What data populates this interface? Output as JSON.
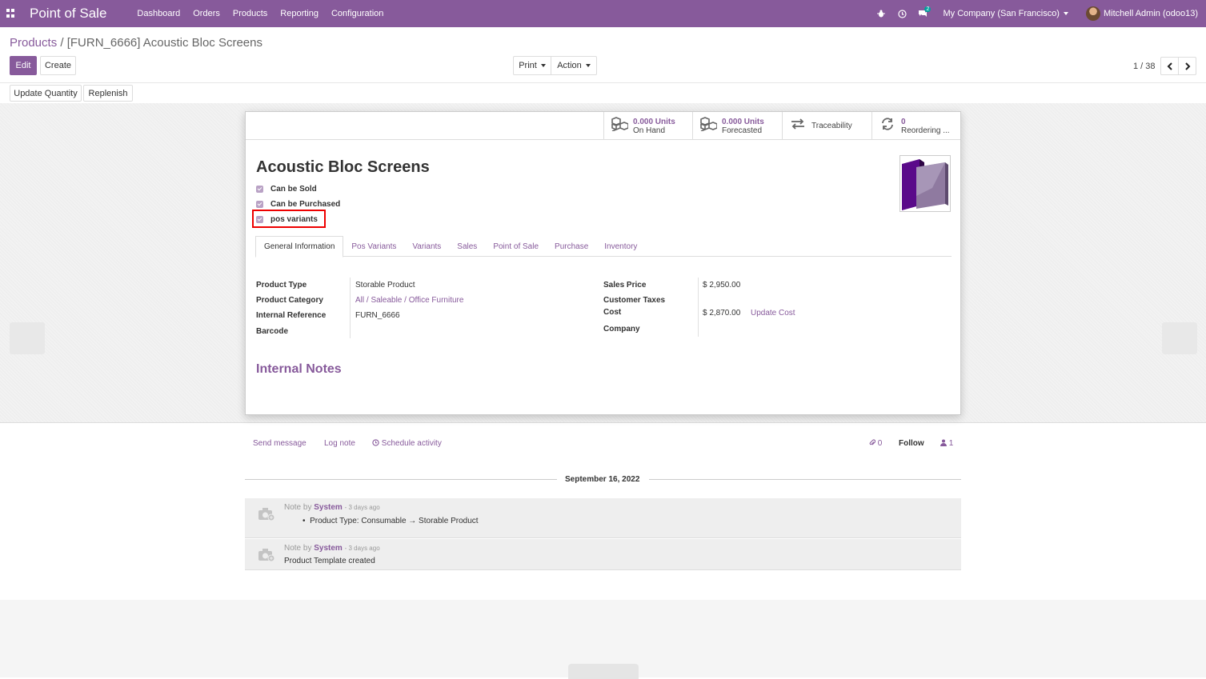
{
  "navbar": {
    "app_title": "Point of Sale",
    "menu": [
      "Dashboard",
      "Orders",
      "Products",
      "Reporting",
      "Configuration"
    ],
    "chat_count": "2",
    "company": "My Company (San Francisco)",
    "user": "Mitchell Admin (odoo13)"
  },
  "breadcrumb": {
    "parent": "Products",
    "separator": "/",
    "current": "[FURN_6666] Acoustic Bloc Screens"
  },
  "toolbar": {
    "edit": "Edit",
    "create": "Create",
    "print": "Print",
    "action": "Action",
    "pager": "1 / 38",
    "update_quantity": "Update Quantity",
    "replenish": "Replenish"
  },
  "stats": {
    "on_hand_value": "0.000 Units",
    "on_hand_label": "On Hand",
    "forecasted_value": "0.000 Units",
    "forecasted_label": "Forecasted",
    "traceability_label": "Traceability",
    "reordering_value": "0",
    "reordering_label": "Reordering ..."
  },
  "product": {
    "name": "Acoustic Bloc Screens",
    "can_be_sold": "Can be Sold",
    "can_be_purchased": "Can be Purchased",
    "pos_variants": "pos variants"
  },
  "tabs": [
    "General Information",
    "Pos Variants",
    "Variants",
    "Sales",
    "Point of Sale",
    "Purchase",
    "Inventory"
  ],
  "fields": {
    "product_type_label": "Product Type",
    "product_type_value": "Storable Product",
    "product_category_label": "Product Category",
    "product_category_value": "All / Saleable / Office Furniture",
    "internal_reference_label": "Internal Reference",
    "internal_reference_value": "FURN_6666",
    "barcode_label": "Barcode",
    "sales_price_label": "Sales Price",
    "sales_price_value": "$ 2,950.00",
    "customer_taxes_label": "Customer Taxes",
    "cost_label": "Cost",
    "cost_value": "$ 2,870.00",
    "update_cost": "Update Cost",
    "company_label": "Company"
  },
  "internal_notes_title": "Internal Notes",
  "chatter": {
    "send_message": "Send message",
    "log_note": "Log note",
    "schedule_activity": "Schedule activity",
    "attachments_count": "0",
    "follow": "Follow",
    "followers_count": "1",
    "date": "September 16, 2022",
    "messages": [
      {
        "prefix": "Note by",
        "author": "System",
        "time": "- 3 days ago",
        "body": "Product Type: Consumable → Storable Product"
      },
      {
        "prefix": "Note by",
        "author": "System",
        "time": "- 3 days ago",
        "body": "Product Template created"
      }
    ]
  },
  "colors": {
    "brand": "#875a9b",
    "highlight": "#e00000"
  },
  "icons": [
    "apps-icon",
    "bug-icon",
    "clock-icon",
    "chat-icon",
    "avatar",
    "cubes-icon",
    "exchange-icon",
    "refresh-icon",
    "paperclip-icon",
    "user-icon",
    "camera-icon"
  ]
}
